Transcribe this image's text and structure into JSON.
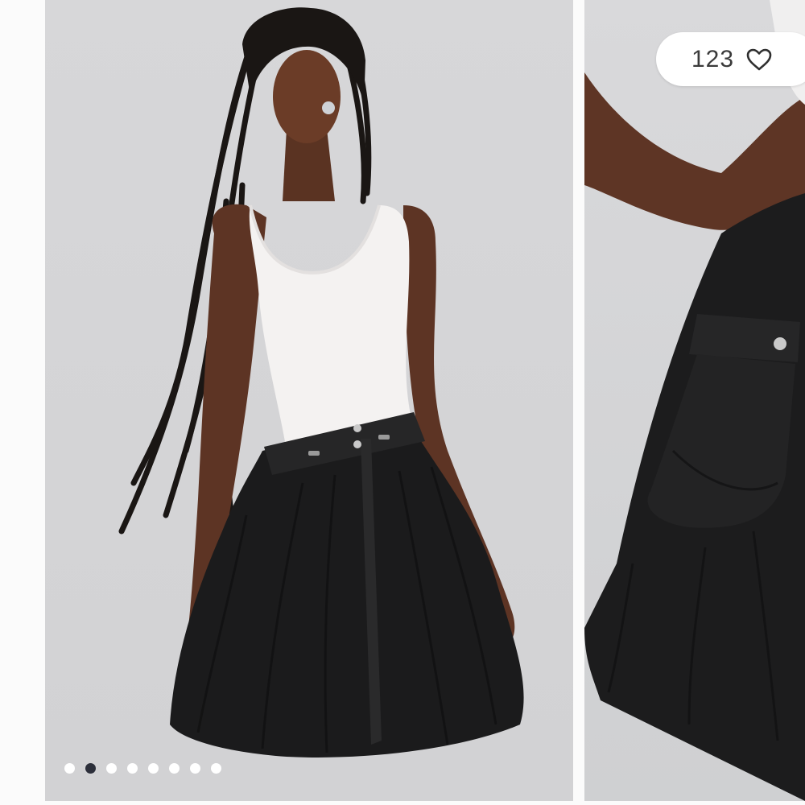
{
  "like": {
    "count": "123",
    "icon": "heart-outline-icon"
  },
  "carousel": {
    "slide_count": 8,
    "active_index": 1,
    "dot_colors": {
      "active": "#2c2f3a",
      "inactive": "#ffffff"
    }
  },
  "colors": {
    "background": "#fbfbfb",
    "photo_backdrop": "#d4d4d6"
  }
}
